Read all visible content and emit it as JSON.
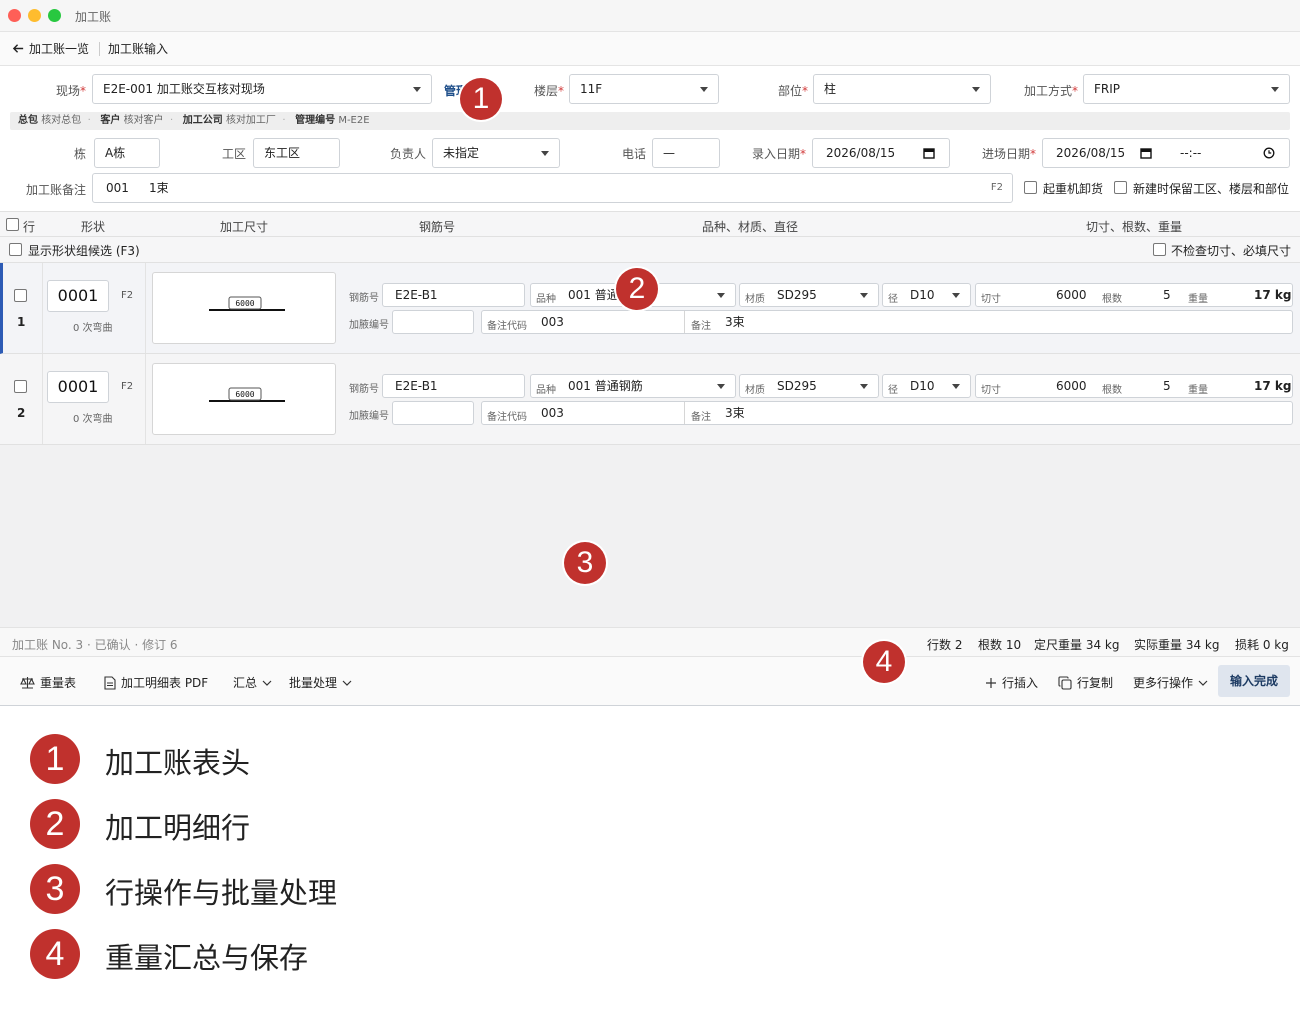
{
  "window": {
    "title": "加工账"
  },
  "nav": {
    "back_label": "加工账一览",
    "current": "加工账输入"
  },
  "header": {
    "site_label": "现场",
    "site_value": "E2E-001 加工账交互核对现场",
    "mgmt_link": "管理",
    "floor_label": "楼层",
    "floor_value": "11F",
    "part_label": "部位",
    "part_value": "柱",
    "method_label": "加工方式",
    "method_value": "FRIP",
    "req_mark": "*",
    "info": {
      "gc_label": "总包",
      "gc_value": "核对总包",
      "client_label": "客户",
      "client_value": "核对客户",
      "proc_label": "加工公司",
      "proc_value": "核对加工厂",
      "mgmt_label": "管理编号",
      "mgmt_value": "M-E2E",
      "sep": "·"
    },
    "building_label": "栋",
    "building_value": "A栋",
    "zone_label": "工区",
    "zone_value": "东工区",
    "owner_label": "负责人",
    "owner_value": "未指定",
    "phone_label": "电话",
    "phone_value": "—",
    "entry_date_label": "录入日期",
    "entry_date_value": "2026/08/15",
    "arrival_date_label": "进场日期",
    "arrival_date_value": "2026/08/15",
    "arrival_time_value": "--:--",
    "note_label": "加工账备注",
    "note_code": "001",
    "note_text": "1束",
    "note_hotkey": "F2",
    "crane_label": "起重机卸货",
    "keep_label": "新建时保留工区、楼层和部位"
  },
  "columns": {
    "row": "行",
    "shape": "形状",
    "size": "加工尺寸",
    "bar_no": "钢筋号",
    "grade": "品种、材质、直径",
    "cut": "切寸、根数、重量"
  },
  "shape_bar": {
    "show_candidates": "显示形状组候选 (F3)",
    "no_check": "不检查切寸、必填尺寸"
  },
  "field_labels": {
    "bar_no": "钢筋号",
    "kind": "品种",
    "material": "材质",
    "dia": "径",
    "cut": "切寸",
    "count": "根数",
    "weight": "重量",
    "rib": "加腋编号",
    "remark_code": "备注代码",
    "remark": "备注"
  },
  "rows": [
    {
      "index": "1",
      "shape_code": "0001",
      "hotkey": "F2",
      "bends": "0 次弯曲",
      "dim": "6000",
      "bar_no": "E2E-B1",
      "kind": "001 普通钢筋",
      "material": "SD295",
      "dia": "D10",
      "cut": "6000",
      "count": "5",
      "weight": "17 kg",
      "rib": "",
      "remark_code": "003",
      "remark": "3束"
    },
    {
      "index": "2",
      "shape_code": "0001",
      "hotkey": "F2",
      "bends": "0 次弯曲",
      "dim": "6000",
      "bar_no": "E2E-B1",
      "kind": "001 普通钢筋",
      "material": "SD295",
      "dia": "D10",
      "cut": "6000",
      "count": "5",
      "weight": "17 kg",
      "rib": "",
      "remark_code": "003",
      "remark": "3束"
    }
  ],
  "status": {
    "left": "加工账 No. 3 · 已确认 · 修订 6",
    "rows": "行数 2",
    "count": "根数 10",
    "std_weight": "定尺重量 34 kg",
    "actual_weight": "实际重量 34 kg",
    "loss": "损耗 0 kg"
  },
  "toolbar": {
    "weight_table": "重量表",
    "pdf": "加工明细表 PDF",
    "summary": "汇总",
    "batch": "批量处理",
    "insert_row": "行插入",
    "copy_row": "行复制",
    "more": "更多行操作",
    "done": "输入完成"
  },
  "markers": {
    "m1": "1",
    "m2": "2",
    "m3": "3",
    "m4": "4"
  },
  "legend": [
    {
      "num": "1",
      "text": "加工账表头"
    },
    {
      "num": "2",
      "text": "加工明细行"
    },
    {
      "num": "3",
      "text": "行操作与批量处理"
    },
    {
      "num": "4",
      "text": "重量汇总与保存"
    }
  ],
  "colors": {
    "accent": "#2d5bb5",
    "marker": "#c0312d"
  }
}
